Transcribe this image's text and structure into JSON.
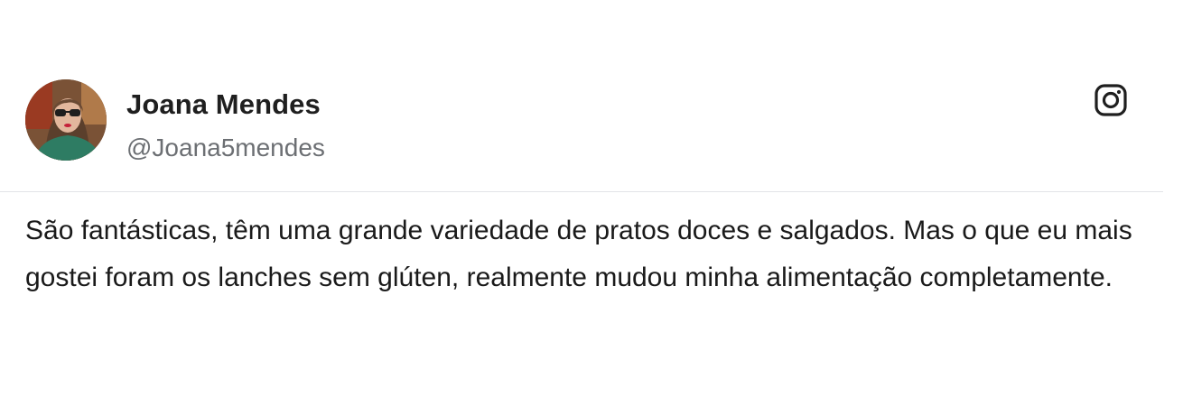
{
  "post": {
    "author_name": "Joana Mendes",
    "author_handle": "@Joana5mendes",
    "text": "São fantásticas, têm uma grande variedade de pratos doces e salgados. Mas o que eu mais gostei foram os lanches sem glúten, realmente mudou minha alimentação completamente.",
    "platform_icon": "instagram-icon",
    "avatar_icon": "avatar-photo"
  },
  "colors": {
    "name": "#1f1f1f",
    "handle": "#6c6f73",
    "text": "#1a1a1a",
    "divider": "#e2e4e7",
    "background": "#ffffff"
  }
}
